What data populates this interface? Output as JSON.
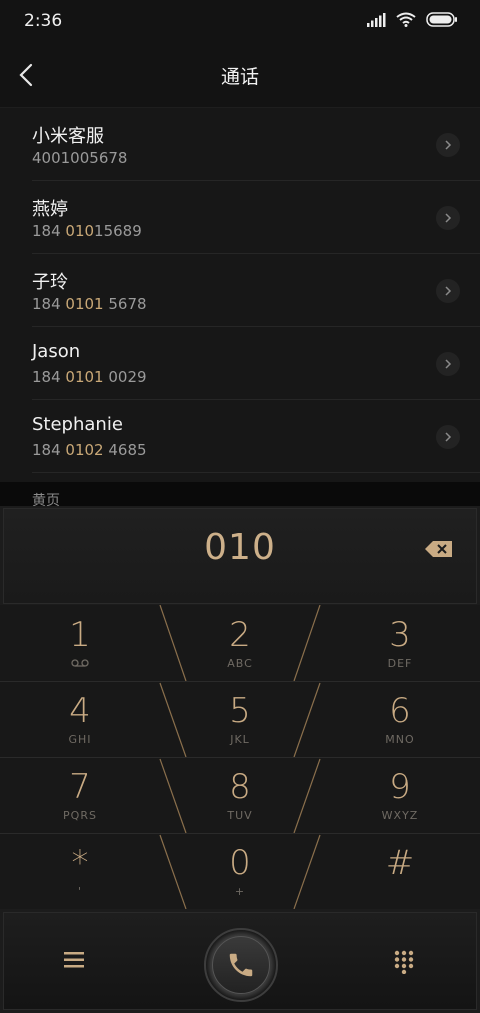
{
  "status": {
    "time": "2:36"
  },
  "header": {
    "title": "通话"
  },
  "contacts": [
    {
      "name": "小米客服",
      "num_pre": "400",
      "num_hl": "",
      "num_post": "1005678"
    },
    {
      "name": "燕婷",
      "num_pre": "184 ",
      "num_hl": "010",
      "num_post": "15689"
    },
    {
      "name": "子玲",
      "num_pre": "184 ",
      "num_hl": "0101",
      "num_post": " 5678"
    },
    {
      "name": "Jason",
      "num_pre": "184 ",
      "num_hl": "0101",
      "num_post": " 0029"
    },
    {
      "name": "Stephanie",
      "num_pre": "184 ",
      "num_hl": "0102",
      "num_post": " 4685"
    }
  ],
  "section_label": "黄页",
  "dialer": {
    "digits": "010",
    "keys": [
      {
        "digit": "1",
        "letters": ""
      },
      {
        "digit": "2",
        "letters": "ABC"
      },
      {
        "digit": "3",
        "letters": "DEF"
      },
      {
        "digit": "4",
        "letters": "GHI"
      },
      {
        "digit": "5",
        "letters": "JKL"
      },
      {
        "digit": "6",
        "letters": "MNO"
      },
      {
        "digit": "7",
        "letters": "PQRS"
      },
      {
        "digit": "8",
        "letters": "TUV"
      },
      {
        "digit": "9",
        "letters": "WXYZ"
      },
      {
        "digit": "*",
        "letters": "'"
      },
      {
        "digit": "0",
        "letters": "+"
      },
      {
        "digit": "#",
        "letters": ""
      }
    ]
  },
  "colors": {
    "accent": "#c9ab84",
    "background": "#171717"
  }
}
